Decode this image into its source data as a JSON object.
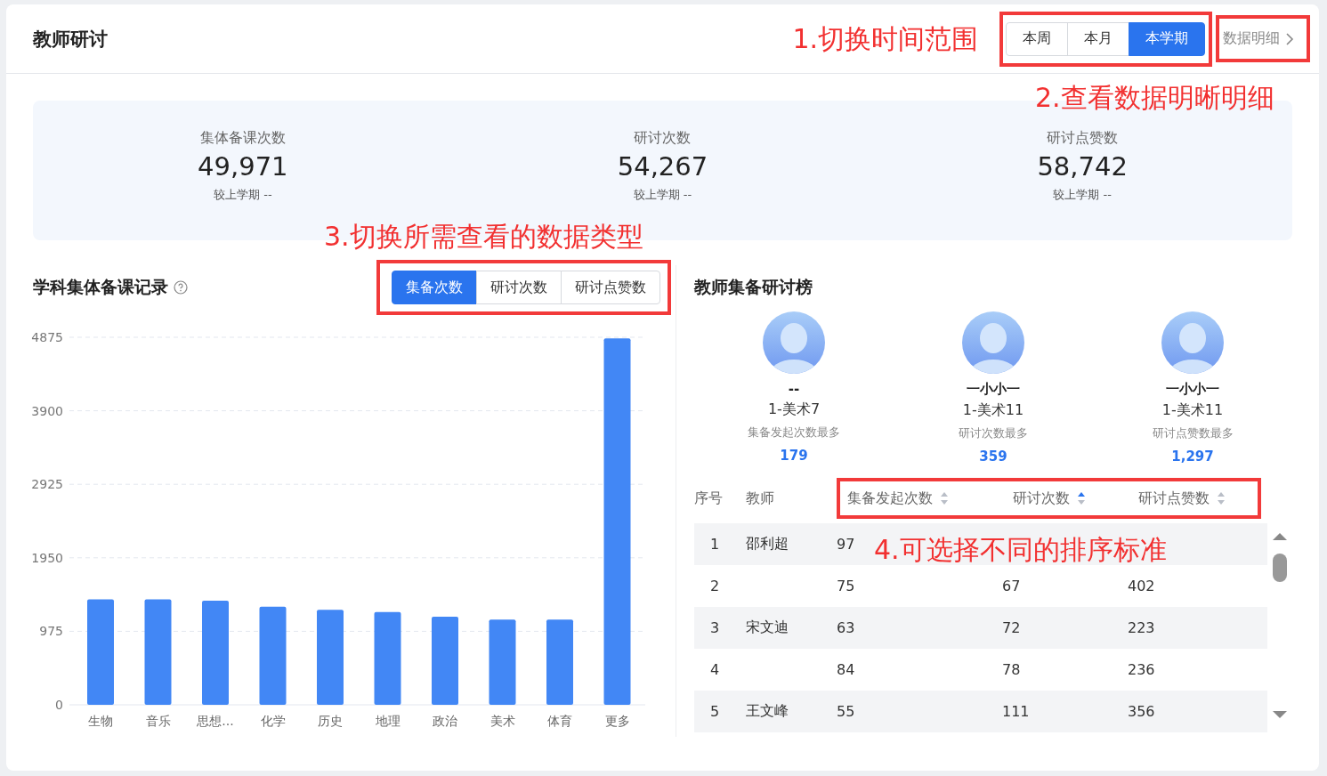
{
  "header": {
    "title": "教师研讨",
    "periods": [
      {
        "label": "本周",
        "selected": false
      },
      {
        "label": "本月",
        "selected": false
      },
      {
        "label": "本学期",
        "selected": true
      }
    ],
    "detail_link": "数据明细"
  },
  "annotations": [
    {
      "text": "1.切换时间范围"
    },
    {
      "text": "2.查看数据明晰明细"
    },
    {
      "text": "3.切换所需查看的数据类型"
    },
    {
      "text": "4.可选择不同的排序标准"
    }
  ],
  "stats": [
    {
      "label": "集体备课次数",
      "value": "49,971",
      "compare": "较上学期 --"
    },
    {
      "label": "研讨次数",
      "value": "54,267",
      "compare": "较上学期 --"
    },
    {
      "label": "研讨点赞数",
      "value": "58,742",
      "compare": "较上学期 --"
    }
  ],
  "subject_panel": {
    "title": "学科集体备课记录",
    "metric_tabs": [
      {
        "label": "集备次数",
        "selected": true
      },
      {
        "label": "研讨次数",
        "selected": false
      },
      {
        "label": "研讨点赞数",
        "selected": false
      }
    ],
    "chart_data": {
      "type": "bar",
      "categories": [
        "生物",
        "音乐",
        "思想...",
        "化学",
        "历史",
        "地理",
        "政治",
        "美术",
        "体育",
        "更多"
      ],
      "values": [
        1400,
        1400,
        1380,
        1300,
        1260,
        1230,
        1170,
        1130,
        1130,
        4860
      ],
      "ylim": [
        0,
        4875
      ],
      "yticks": [
        0,
        975,
        1950,
        2925,
        3900,
        4875
      ],
      "grid": true
    }
  },
  "ranking_panel": {
    "title": "教师集备研讨榜",
    "podium": [
      {
        "name": "--",
        "group": "1-美术7",
        "caption": "集备发起次数最多",
        "value": "179"
      },
      {
        "name": "一小小一",
        "group": "1-美术11",
        "caption": "研讨次数最多",
        "value": "359"
      },
      {
        "name": "一小小一",
        "group": "1-美术11",
        "caption": "研讨点赞数最多",
        "value": "1,297"
      }
    ],
    "columns": [
      {
        "label": "序号",
        "kind": "plain"
      },
      {
        "label": "教师",
        "kind": "plain"
      },
      {
        "label": "集备发起次数",
        "kind": "sortable",
        "sorted": false
      },
      {
        "label": "研讨次数",
        "kind": "sortable",
        "sorted": true
      },
      {
        "label": "研讨点赞数",
        "kind": "sortable",
        "sorted": false
      }
    ],
    "rows": [
      [
        "1",
        "邵利超",
        "97",
        null,
        null
      ],
      [
        "2",
        "",
        "75",
        "67",
        "402"
      ],
      [
        "3",
        "宋文迪",
        "63",
        "72",
        "223"
      ],
      [
        "4",
        "",
        "84",
        "78",
        "236"
      ],
      [
        "5",
        "王文峰",
        "55",
        "111",
        "356"
      ]
    ]
  }
}
